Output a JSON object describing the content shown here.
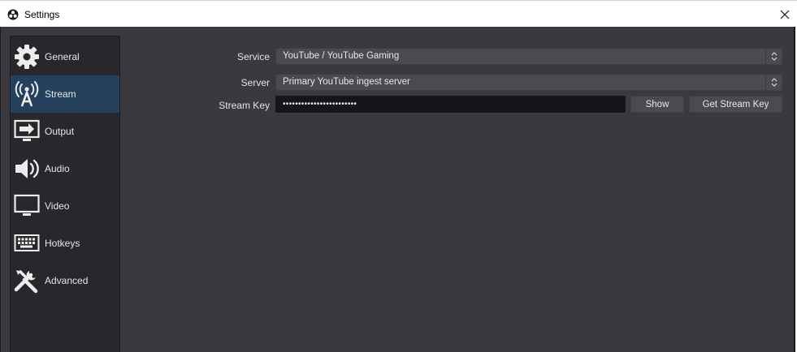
{
  "window": {
    "title": "Settings",
    "app_icon": "obs-logo-icon",
    "close_icon": "close-icon"
  },
  "sidebar": {
    "items": [
      {
        "label": "General",
        "icon": "gear-icon",
        "active": false
      },
      {
        "label": "Stream",
        "icon": "broadcast-antenna-icon",
        "active": true
      },
      {
        "label": "Output",
        "icon": "output-monitor-icon",
        "active": false
      },
      {
        "label": "Audio",
        "icon": "speaker-icon",
        "active": false
      },
      {
        "label": "Video",
        "icon": "monitor-icon",
        "active": false
      },
      {
        "label": "Hotkeys",
        "icon": "keyboard-icon",
        "active": false
      },
      {
        "label": "Advanced",
        "icon": "tools-icon",
        "active": false
      }
    ]
  },
  "stream": {
    "service_label": "Service",
    "service_value": "YouTube / YouTube Gaming",
    "server_label": "Server",
    "server_value": "Primary YouTube ingest server",
    "key_label": "Stream Key",
    "key_value": "••••••••••••••••••••••••",
    "show_button": "Show",
    "get_key_button": "Get Stream Key"
  },
  "colors": {
    "window_bg": "#3a393e",
    "sidebar_bg": "#28272b",
    "active_item": "#23405c",
    "input_bg": "#4b4a50",
    "key_bg": "#161519",
    "text": "#e6e6e6"
  }
}
